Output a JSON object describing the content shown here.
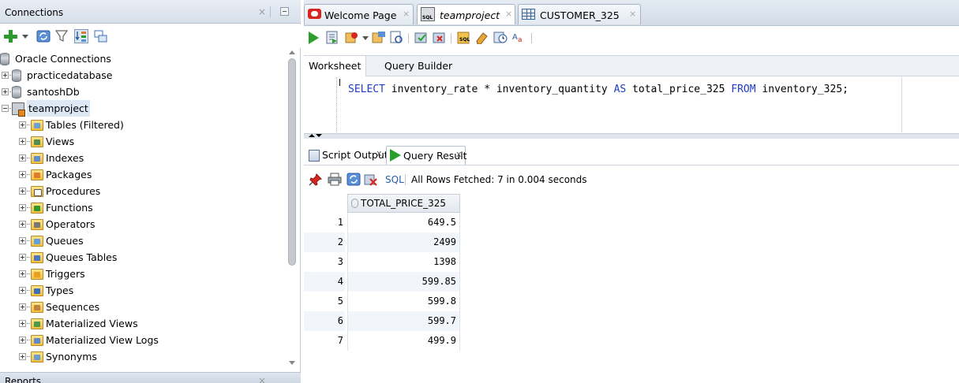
{
  "connections_panel": {
    "title": "Connections",
    "close_glyph": "×",
    "tree": [
      {
        "label": "Oracle Connections",
        "indent": 0,
        "icon": "database-cylinder-icon",
        "expander": "none"
      },
      {
        "label": "practicedatabase",
        "indent": 1,
        "icon": "database-cylinder-icon",
        "expander": "plus"
      },
      {
        "label": "santoshDb",
        "indent": 1,
        "icon": "database-cylinder-icon",
        "expander": "plus"
      },
      {
        "label": "teamproject",
        "indent": 1,
        "icon": "connection-icon",
        "expander": "minus",
        "selected": true
      },
      {
        "label": "Tables (Filtered)",
        "indent": 2,
        "icon": "tables-folder-icon",
        "expander": "plus"
      },
      {
        "label": "Views",
        "indent": 2,
        "icon": "views-folder-icon",
        "expander": "plus"
      },
      {
        "label": "Indexes",
        "indent": 2,
        "icon": "indexes-folder-icon",
        "expander": "plus"
      },
      {
        "label": "Packages",
        "indent": 2,
        "icon": "packages-folder-icon",
        "expander": "plus"
      },
      {
        "label": "Procedures",
        "indent": 2,
        "icon": "procedures-folder-icon",
        "expander": "plus"
      },
      {
        "label": "Functions",
        "indent": 2,
        "icon": "functions-folder-icon",
        "expander": "plus"
      },
      {
        "label": "Operators",
        "indent": 2,
        "icon": "operators-folder-icon",
        "expander": "plus"
      },
      {
        "label": "Queues",
        "indent": 2,
        "icon": "queues-folder-icon",
        "expander": "plus"
      },
      {
        "label": "Queues Tables",
        "indent": 2,
        "icon": "queues-tables-folder-icon",
        "expander": "plus"
      },
      {
        "label": "Triggers",
        "indent": 2,
        "icon": "triggers-folder-icon",
        "expander": "plus"
      },
      {
        "label": "Types",
        "indent": 2,
        "icon": "types-folder-icon",
        "expander": "plus"
      },
      {
        "label": "Sequences",
        "indent": 2,
        "icon": "sequences-folder-icon",
        "expander": "plus"
      },
      {
        "label": "Materialized Views",
        "indent": 2,
        "icon": "materialized-views-folder-icon",
        "expander": "plus"
      },
      {
        "label": "Materialized View Logs",
        "indent": 2,
        "icon": "materialized-view-logs-folder-icon",
        "expander": "plus"
      },
      {
        "label": "Synonyms",
        "indent": 2,
        "icon": "synonyms-folder-icon",
        "expander": "plus"
      }
    ]
  },
  "reports_panel": {
    "title": "Reports",
    "close_glyph": "×"
  },
  "editor_tabs": [
    {
      "label": "Welcome Page",
      "icon": "oracle-logo-icon",
      "italic": false,
      "active": false
    },
    {
      "label": "teamproject",
      "icon": "sql-worksheet-icon",
      "italic": true,
      "active": true
    },
    {
      "label": "CUSTOMER_325",
      "icon": "table-grid-icon",
      "italic": false,
      "active": false
    }
  ],
  "tab_close_glyph": "×",
  "worksheet": {
    "subtabs": [
      "Worksheet",
      "Query Builder"
    ],
    "sql_parts": [
      {
        "text": "SELECT",
        "keyword": true
      },
      {
        "text": " inventory_rate * inventory_quantity ",
        "keyword": false
      },
      {
        "text": "AS",
        "keyword": true
      },
      {
        "text": " total_price_325 ",
        "keyword": false
      },
      {
        "text": "FROM",
        "keyword": true
      },
      {
        "text": " inventory_325;",
        "keyword": false
      }
    ]
  },
  "output": {
    "tabs": [
      {
        "label": "Script Output",
        "icon": "script-output-icon",
        "active": false
      },
      {
        "label": "Query Result",
        "icon": "query-result-icon",
        "active": true
      }
    ],
    "close_glyph": "x",
    "sql_link": "SQL",
    "status": "All Rows Fetched: 7 in 0.004 seconds",
    "column_header": "TOTAL_PRICE_325",
    "rows": [
      {
        "num": "1",
        "value": "649.5"
      },
      {
        "num": "2",
        "value": "2499"
      },
      {
        "num": "3",
        "value": "1398"
      },
      {
        "num": "4",
        "value": "599.85"
      },
      {
        "num": "5",
        "value": "599.8"
      },
      {
        "num": "6",
        "value": "599.7"
      },
      {
        "num": "7",
        "value": "499.9"
      }
    ]
  },
  "colors": {
    "sql_keyword": "#1e3cc8",
    "run_green": "#2aa02a",
    "add_green": "#2e9a2e",
    "oracle_red": "#d7261e"
  }
}
